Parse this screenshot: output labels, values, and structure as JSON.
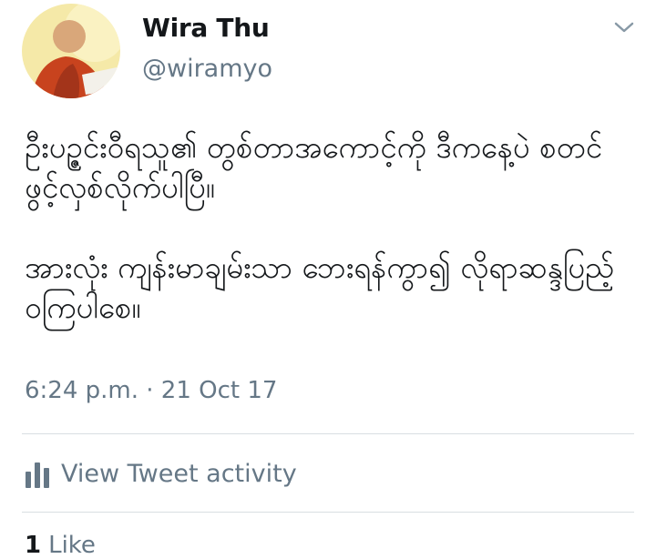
{
  "tweet": {
    "author": {
      "display_name": "Wira Thu",
      "handle": "@wiramyo"
    },
    "text_paragraphs": [
      "ဦးပဥ္ဇင်းဝီရသူ၏ တွစ်တာအကောင့်ကို ဒီကနေ့ပဲ စတင် ဖွင့်လှစ်လိုက်ပါပြီ။",
      "အားလုံး ကျန်းမာချမ်းသာ ဘေးရန်ကွာ၍ လိုရာဆန္ဒပြည့်ဝကြပါစေ။"
    ],
    "timestamp": "6:24 p.m. · 21 Oct 17"
  },
  "actions": {
    "activity_label": "View Tweet activity"
  },
  "likes": {
    "count": "1",
    "label": "Like"
  },
  "icons": {
    "more": "chevron-down-icon",
    "activity": "bar-chart-icon"
  },
  "colors": {
    "text_primary": "#14171a",
    "text_secondary": "#657786",
    "divider": "#d9dee2"
  }
}
